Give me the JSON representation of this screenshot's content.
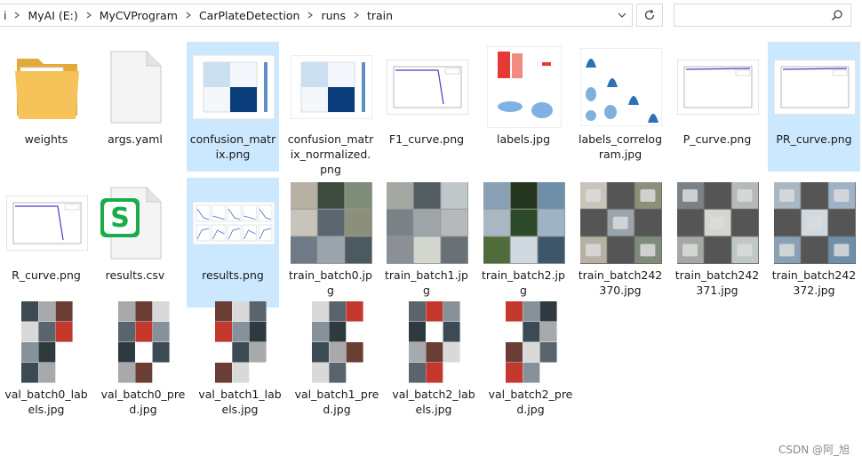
{
  "address": {
    "crumbs": [
      "i",
      "MyAI (E:)",
      "MyCVProgram",
      "CarPlateDetection",
      "runs",
      "train"
    ]
  },
  "search": {
    "placeholder": ""
  },
  "files": [
    {
      "name": "weights",
      "kind": "folder",
      "selected": false
    },
    {
      "name": "args.yaml",
      "kind": "document",
      "selected": false
    },
    {
      "name": "confusion_matrix.png",
      "kind": "confusion",
      "selected": true
    },
    {
      "name": "confusion_matrix_normalized.png",
      "kind": "confusion",
      "selected": false
    },
    {
      "name": "F1_curve.png",
      "kind": "curve-drop",
      "selected": false
    },
    {
      "name": "labels.jpg",
      "kind": "labels-plot",
      "selected": false
    },
    {
      "name": "labels_correlogram.jpg",
      "kind": "correlogram",
      "selected": false
    },
    {
      "name": "P_curve.png",
      "kind": "curve-flat",
      "selected": false
    },
    {
      "name": "PR_curve.png",
      "kind": "curve-flat",
      "selected": true
    },
    {
      "name": "R_curve.png",
      "kind": "curve-drop",
      "selected": false
    },
    {
      "name": "results.csv",
      "kind": "csv",
      "selected": false
    },
    {
      "name": "results.png",
      "kind": "results-plot",
      "selected": true
    },
    {
      "name": "train_batch0.jpg",
      "kind": "photo-grid",
      "selected": false
    },
    {
      "name": "train_batch1.jpg",
      "kind": "photo-grid",
      "selected": false
    },
    {
      "name": "train_batch2.jpg",
      "kind": "photo-grid",
      "selected": false
    },
    {
      "name": "train_batch242370.jpg",
      "kind": "photo-grid-dark",
      "selected": false
    },
    {
      "name": "train_batch242371.jpg",
      "kind": "photo-grid-dark",
      "selected": false
    },
    {
      "name": "train_batch242372.jpg",
      "kind": "photo-grid-dark",
      "selected": false
    },
    {
      "name": "val_batch0_labels.jpg",
      "kind": "val-grid",
      "selected": false
    },
    {
      "name": "val_batch0_pred.jpg",
      "kind": "val-grid",
      "selected": false
    },
    {
      "name": "val_batch1_labels.jpg",
      "kind": "val-grid",
      "selected": false
    },
    {
      "name": "val_batch1_pred.jpg",
      "kind": "val-grid",
      "selected": false
    },
    {
      "name": "val_batch2_labels.jpg",
      "kind": "val-grid",
      "selected": false
    },
    {
      "name": "val_batch2_pred.jpg",
      "kind": "val-grid",
      "selected": false
    }
  ],
  "watermark": "CSDN @阿_旭",
  "colors": {
    "selection": "#cce8ff",
    "folder": "#f5c35a",
    "matrix_dark": "#0b3d7a",
    "csv_green": "#1aab4b"
  },
  "icons": [
    "chevron-right-icon",
    "chevron-down-icon",
    "refresh-icon",
    "search-icon"
  ]
}
